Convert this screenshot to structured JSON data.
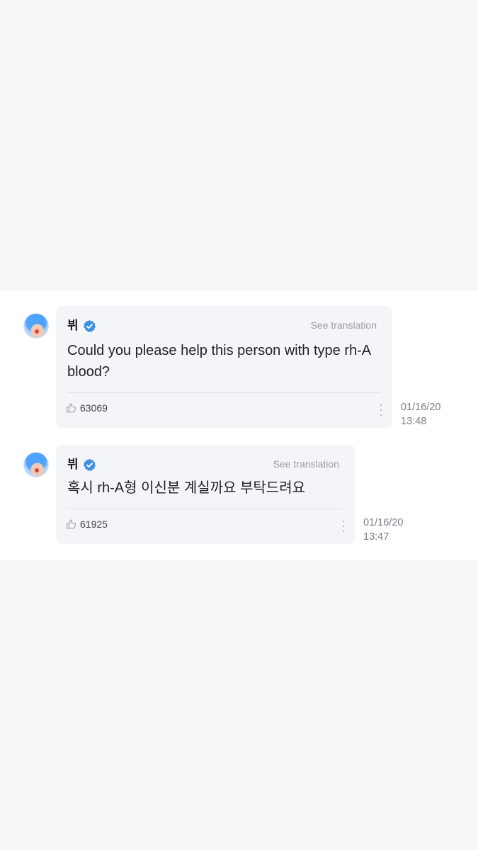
{
  "posts": [
    {
      "author": "뷔",
      "see_translation": "See translation",
      "message": "Could you please help this person with type rh-A blood?",
      "likes": "63069",
      "date": "01/16/20",
      "time": "13:48",
      "avatar_icon": "avatar-image",
      "verified_icon": "verified-badge-icon",
      "like_icon": "thumbs-up-icon",
      "more_icon": "more-vertical-icon"
    },
    {
      "author": "뷔",
      "see_translation": "See translation",
      "message": "혹시 rh-A형 이신분 계실까요 부탁드려요",
      "likes": "61925",
      "date": "01/16/20",
      "time": "13:47",
      "avatar_icon": "avatar-image",
      "verified_icon": "verified-badge-icon",
      "like_icon": "thumbs-up-icon",
      "more_icon": "more-vertical-icon"
    }
  ],
  "colors": {
    "page_background": "#f7f7fa",
    "feed_background": "#ffffff",
    "bubble_background": "#f4f5f9",
    "verified_blue": "#3f8fe3",
    "muted_text": "#9a9da6"
  }
}
